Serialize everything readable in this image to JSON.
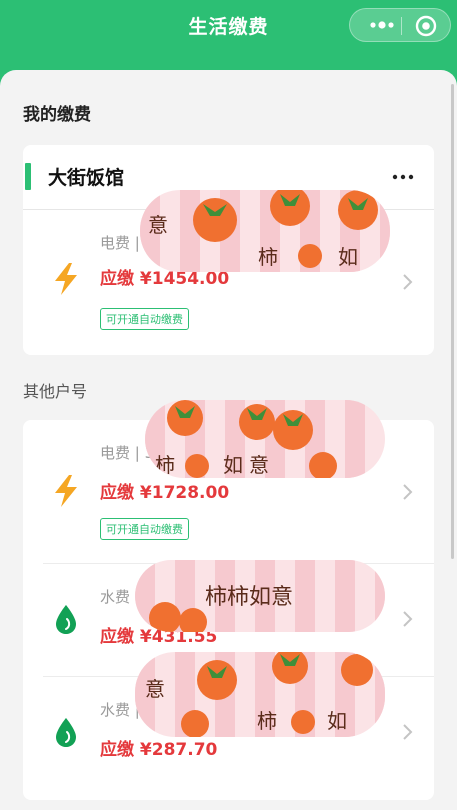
{
  "header": {
    "title": "生活缴费",
    "capsule_more_icon": "more-dots-icon",
    "capsule_close_icon": "target-icon"
  },
  "my_payments": {
    "title": "我的缴费",
    "card": {
      "name": "大街饭馆",
      "rows": [
        {
          "icon": "lightning-icon",
          "account": "电费 |",
          "due": "应缴 ¥1454.00",
          "autopay": "可开通自动缴费"
        }
      ]
    }
  },
  "other_accounts": {
    "title": "其他户号",
    "rows": [
      {
        "icon": "lightning-icon",
        "account": "电费 | 3",
        "due": "应缴 ¥1728.00",
        "autopay": "可开通自动缴费"
      },
      {
        "icon": "water-drop-icon",
        "account": "水费 |",
        "due": "应缴 ¥431.55"
      },
      {
        "icon": "water-drop-icon",
        "account": "水费 |",
        "due": "应缴 ¥287.70"
      }
    ]
  },
  "sticker_text": "柿柿如意",
  "colors": {
    "brand_green": "#2cbf74",
    "due_red": "#e4393c",
    "lightning": "#f5a623",
    "persimmon": "#f07030"
  }
}
